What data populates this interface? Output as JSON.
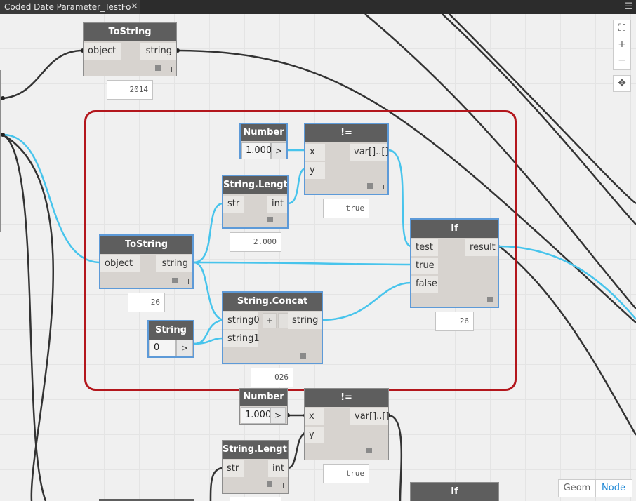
{
  "tab": {
    "title": "Coded Date Parameter_TestFo",
    "close": "✕"
  },
  "menu_icon": "hamburger-menu-icon",
  "nodes": {
    "tostring_top": {
      "title": "ToString",
      "in": [
        "object"
      ],
      "out": [
        "string"
      ],
      "preview": "2014"
    },
    "number_1": {
      "title": "Number",
      "value": "1.000",
      "arrow": ">"
    },
    "neq_1": {
      "title": "!=",
      "in": [
        "x",
        "y"
      ],
      "out": [
        "var[]..[]"
      ],
      "preview": "true"
    },
    "strlen_1": {
      "title": "String.Length",
      "in": [
        "str"
      ],
      "out": [
        "int"
      ],
      "preview": "2.000"
    },
    "tostring_mid": {
      "title": "ToString",
      "in": [
        "object"
      ],
      "out": [
        "string"
      ],
      "preview": "26"
    },
    "if_1": {
      "title": "If",
      "in": [
        "test",
        "true",
        "false"
      ],
      "out": [
        "result"
      ],
      "preview": "26"
    },
    "string_1": {
      "title": "String",
      "value": "0",
      "arrow": ">"
    },
    "concat_1": {
      "title": "String.Concat",
      "in": [
        "string0",
        "string1"
      ],
      "out": [
        "string"
      ],
      "plus": "+",
      "minus": "-",
      "preview": "026"
    },
    "number_2": {
      "title": "Number",
      "value": "1.000",
      "arrow": ">"
    },
    "neq_2": {
      "title": "!=",
      "in": [
        "x",
        "y"
      ],
      "out": [
        "var[]..[]"
      ],
      "preview": "true"
    },
    "strlen_2": {
      "title": "String.Length",
      "in": [
        "str"
      ],
      "out": [
        "int"
      ]
    },
    "if_2": {
      "title": "If"
    }
  },
  "nav": {
    "fit": "fit-view-icon",
    "zoom_in": "+",
    "zoom_out": "−",
    "pan": "pan-icon"
  },
  "view_toggle": {
    "geom": "Geom",
    "node": "Node",
    "active": "Node"
  },
  "colors": {
    "selected_wire": "#47c4ec",
    "wire": "#333333",
    "group_border": "#b3161c",
    "selection": "#5d9ad8",
    "node_header": "#5e5e5e"
  }
}
